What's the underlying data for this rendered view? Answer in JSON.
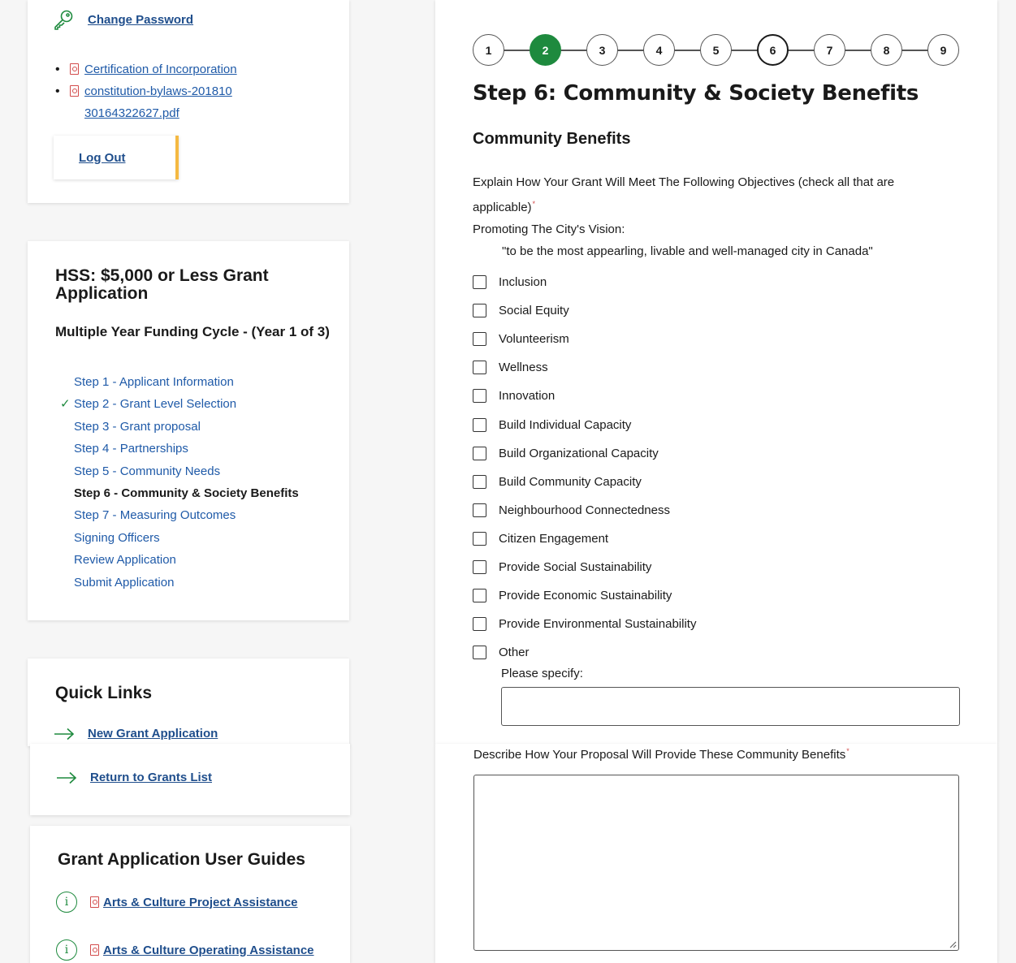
{
  "account": {
    "change_password": "Change Password",
    "documents": [
      {
        "label": "Certification of Incorporation"
      },
      {
        "label": "constitution-bylaws-20181030164322627.pdf"
      }
    ],
    "logout": "Log Out"
  },
  "nav": {
    "title": "HSS: $5,000 or Less Grant Application",
    "subtitle": "Multiple Year Funding Cycle - (Year 1 of 3)",
    "items": [
      {
        "label": "Step 1 - Applicant Information"
      },
      {
        "label": "Step 2 - Grant Level Selection",
        "check": "✓"
      },
      {
        "label": "Step 3 - Grant proposal"
      },
      {
        "label": "Step 4 - Partnerships"
      },
      {
        "label": "Step 5 - Community Needs"
      },
      {
        "label": "Step 6 - Community & Society Benefits"
      },
      {
        "label": "Step 7 - Measuring Outcomes"
      },
      {
        "label": "Signing Officers"
      },
      {
        "label": "Review Application"
      },
      {
        "label": "Submit Application"
      }
    ]
  },
  "quick_links": {
    "title": "Quick Links",
    "new_grant": "New Grant Application",
    "return_list": "Return to Grants List"
  },
  "guides": {
    "title": "Grant Application User Guides",
    "items": [
      {
        "label": "Arts & Culture Project Assistance"
      },
      {
        "label": "Arts & Culture Operating Assistance"
      }
    ]
  },
  "stepper": {
    "steps": [
      "1",
      "2",
      "3",
      "4",
      "5",
      "6",
      "7",
      "8",
      "9"
    ],
    "completed": "2",
    "current": "6"
  },
  "main": {
    "title": "Step 6: Community & Society Benefits",
    "section_title": "Community Benefits",
    "question": "Explain How Your Grant Will Meet The Following Objectives (check all that are applicable)",
    "required_mark": "*",
    "vision_label": "Promoting The City's Vision:",
    "vision_quote": "\"to be the most appearling, livable and well-managed city in Canada\"",
    "objectives": [
      "Inclusion",
      "Social Equity",
      "Volunteerism",
      "Wellness",
      "Innovation",
      "Build Individual Capacity",
      "Build Organizational Capacity",
      "Build Community Capacity",
      "Neighbourhood Connectedness",
      "Citizen Engagement",
      "Provide Social Sustainability",
      "Provide Economic Sustainability",
      "Provide Environmental Sustainability",
      "Other"
    ],
    "specify_label": "Please specify:",
    "specify_value": "",
    "describe_label": "Describe How Your Proposal Will Provide These Community Benefits",
    "describe_value": ""
  },
  "colors": {
    "link": "#1f4e8c",
    "nav_link": "#1f5aa8",
    "success": "#1e8a3e",
    "required": "#d24b4b",
    "accent": "#f5b942"
  }
}
